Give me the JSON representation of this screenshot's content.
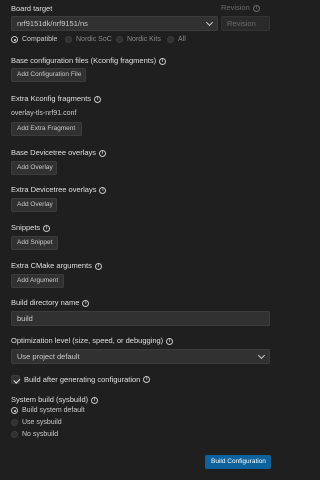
{
  "board": {
    "label": "Board target",
    "value": "nrf9151dk/nrf9151/ns",
    "filters": [
      {
        "label": "Compatible",
        "selected": true
      },
      {
        "label": "Nordic SoC",
        "selected": false
      },
      {
        "label": "Nordic Kits",
        "selected": false
      },
      {
        "label": "All",
        "selected": false
      }
    ]
  },
  "revision": {
    "label": "Revision",
    "placeholder": "Revision"
  },
  "base_config": {
    "label": "Base configuration files (Kconfig fragments)",
    "button": "Add Configuration File"
  },
  "extra_kconfig": {
    "label": "Extra Kconfig fragments",
    "file": "overlay-tls-nrf91.conf",
    "button": "Add Extra Fragment"
  },
  "base_dt": {
    "label": "Base Devicetree overlays",
    "button": "Add Overlay"
  },
  "extra_dt": {
    "label": "Extra Devicetree overlays",
    "button": "Add Overlay"
  },
  "snippets": {
    "label": "Snippets",
    "button": "Add Snippet"
  },
  "cmake": {
    "label": "Extra CMake arguments",
    "button": "Add Argument"
  },
  "build_dir": {
    "label": "Build directory name",
    "value": "build"
  },
  "optimization": {
    "label": "Optimization level (size, speed, or debugging)",
    "value": "Use project default"
  },
  "build_after": {
    "label": "Build after generating configuration",
    "checked": true
  },
  "sysbuild": {
    "label": "System build (sysbuild)",
    "options": [
      {
        "label": "Build system default",
        "selected": true
      },
      {
        "label": "Use sysbuild",
        "selected": false
      },
      {
        "label": "No sysbuild",
        "selected": false
      }
    ]
  },
  "submit": {
    "label": "Build Configuration"
  }
}
